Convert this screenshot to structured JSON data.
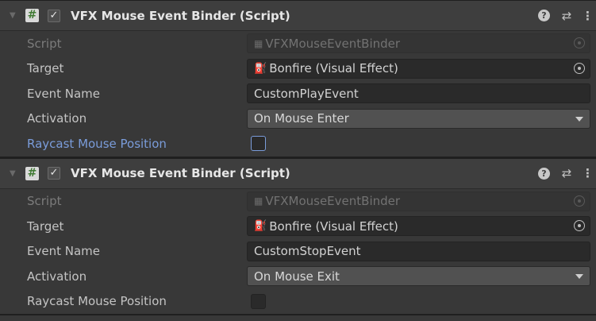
{
  "components": [
    {
      "title": "VFX Mouse Event Binder (Script)",
      "script_icon_glyph": "#",
      "enable_check_glyph": "✓",
      "help_glyph": "?",
      "preset_glyph": "⇄",
      "menu_glyph": "⋮",
      "fields": {
        "script_label": "Script",
        "script_value": "VFXMouseEventBinder",
        "target_label": "Target",
        "target_value": "Bonfire (Visual Effect)",
        "event_name_label": "Event Name",
        "event_name_value": "CustomPlayEvent",
        "activation_label": "Activation",
        "activation_value": "On Mouse Enter",
        "raycast_label": "Raycast Mouse Position",
        "raycast_checked": false,
        "raycast_modified": true
      }
    },
    {
      "title": "VFX Mouse Event Binder (Script)",
      "script_icon_glyph": "#",
      "enable_check_glyph": "✓",
      "help_glyph": "?",
      "preset_glyph": "⇄",
      "menu_glyph": "⋮",
      "fields": {
        "script_label": "Script",
        "script_value": "VFXMouseEventBinder",
        "target_label": "Target",
        "target_value": "Bonfire (Visual Effect)",
        "event_name_label": "Event Name",
        "event_name_value": "CustomStopEvent",
        "activation_label": "Activation",
        "activation_value": "On Mouse Exit",
        "raycast_label": "Raycast Mouse Position",
        "raycast_checked": false,
        "raycast_modified": false
      }
    }
  ],
  "colors": {
    "background": "#383838",
    "header": "#3e3e3e",
    "field": "#2a2a2a",
    "dropdown": "#515151",
    "modified_label": "#7a9cda",
    "disabled_text": "#7b7b7b"
  },
  "icons": {
    "foldout": "foldout-arrow-icon",
    "script": "csharp-script-icon",
    "target": "visual-effect-icon",
    "picker": "object-picker-icon"
  }
}
